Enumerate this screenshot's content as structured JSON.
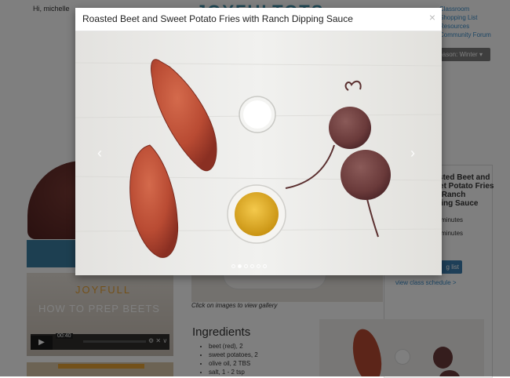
{
  "header": {
    "greeting": "Hi, michelle",
    "logo_text": "JOYFULTOTS"
  },
  "top_nav": {
    "items": [
      "Classroom",
      "Shopping List",
      "Resources",
      "Community Forum"
    ]
  },
  "season_selector": {
    "label": "Season: Winter"
  },
  "sidebar": {
    "recipe_title": "Roasted Beet and Sweet Potato Fries with Ranch Dipping Sauce",
    "prep_time": "minutes",
    "cook_time": "minutes",
    "button_label": "g list",
    "schedule_link": "view class schedule >"
  },
  "video": {
    "brand": "JOYFULL",
    "caption": "HOW TO PREP BEETS",
    "time": "00:40"
  },
  "gallery": {
    "caption": "Click on images to view gallery"
  },
  "ingredients": {
    "heading": "Ingredients",
    "items": [
      "beet (red), 2",
      "sweet potatoes, 2",
      "olive oil, 2 TBS",
      "salt, 1 - 2 tsp"
    ]
  },
  "modal": {
    "title": "Roasted Beet and Sweet Potato Fries with Ranch Dipping Sauce",
    "close": "×",
    "prev": "‹",
    "next": "›",
    "slide_count": 6,
    "active_slide": 1
  },
  "colors": {
    "accent": "#3a7ea3",
    "link": "#3a8cc8",
    "sweet_potato": "#b94b33",
    "beet": "#6a3a3a",
    "oil": "#d8a21b"
  },
  "icons": [
    "close-icon",
    "chevron-left-icon",
    "chevron-right-icon",
    "play-icon"
  ]
}
